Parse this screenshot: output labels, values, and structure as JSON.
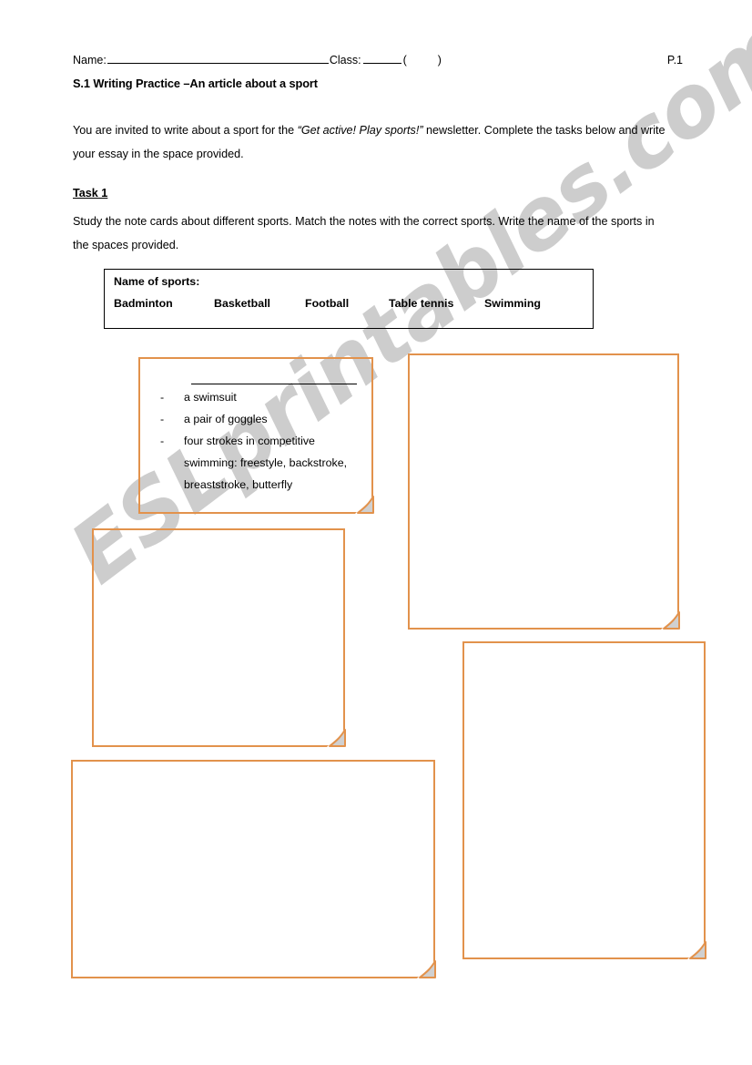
{
  "header": {
    "name_label": "Name:",
    "class_label": "Class:",
    "paren_open": "(",
    "paren_close": ")",
    "page_number": "P.1"
  },
  "document": {
    "title": "S.1 Writing Practice –An article about a sport",
    "intro_before": "You are invited to write about a sport for the ",
    "intro_italic": "“Get active! Play sports!”",
    "intro_after": " newsletter. Complete the tasks below and write your essay in the space provided."
  },
  "task1": {
    "label": "Task 1",
    "instructions": "Study the note cards about different sports. Match the notes with the correct sports. Write the name of the sports in the spaces provided."
  },
  "sports_box": {
    "title": "Name of sports:",
    "options": [
      "Badminton",
      "Basketball",
      "Football",
      "Table tennis",
      "Swimming"
    ]
  },
  "note_cards": [
    {
      "id": "card-1",
      "answer_blank": "",
      "notes": [
        "a swimsuit",
        "a pair of goggles",
        "four strokes in competitive swimming: freestyle, backstroke, breaststroke, butterfly"
      ],
      "bullet_marker": "-"
    },
    {
      "id": "card-2",
      "answer_blank": "",
      "notes": [],
      "bullet_marker": "-"
    },
    {
      "id": "card-3",
      "answer_blank": "",
      "notes": [],
      "bullet_marker": "-"
    },
    {
      "id": "card-4",
      "answer_blank": "",
      "notes": [],
      "bullet_marker": "-"
    },
    {
      "id": "card-5",
      "answer_blank": "",
      "notes": [],
      "bullet_marker": "-"
    }
  ],
  "watermark": {
    "text": "ESLprintables.com"
  },
  "colors": {
    "card_border": "#e2924c",
    "watermark": "#c9c9c9",
    "text": "#000000"
  }
}
